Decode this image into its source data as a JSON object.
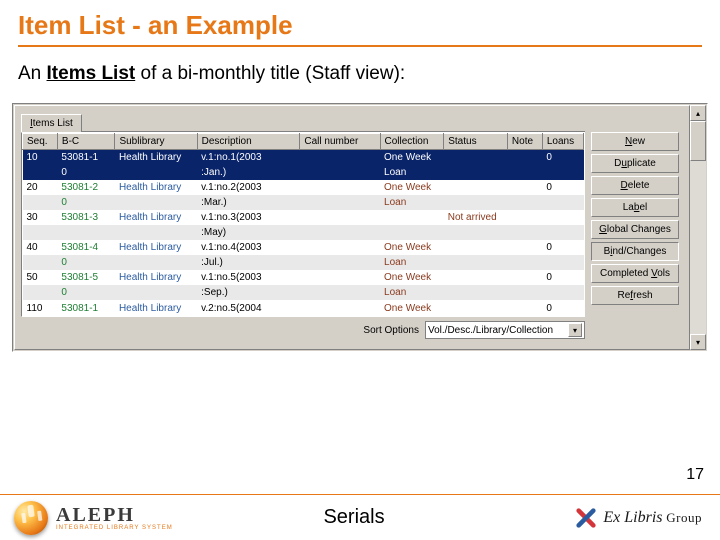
{
  "slide": {
    "title": "Item List - an Example",
    "subtitle_pre": "An ",
    "subtitle_bold": "Items List",
    "subtitle_post": " of a bi-monthly title (Staff view):",
    "page_number": "17",
    "footer_center": "Serials",
    "brand_name": "ALEPH",
    "brand_sub": "INTEGRATED LIBRARY SYSTEM",
    "vendor_prefix": "Ex Libris",
    "vendor_suffix": " Group"
  },
  "tab": {
    "prefix": "I",
    "rest": "tems List"
  },
  "columns": {
    "seq": "Seq.",
    "bc": "B-C",
    "sublibrary": "Sublibrary",
    "description": "Description",
    "callnumber": "Call number",
    "collection": "Collection",
    "status": "Status",
    "note": "Note",
    "loans": "Loans"
  },
  "rows": [
    {
      "seq": "10",
      "bc": "53081-1",
      "bc2": "0",
      "sub": "Health Library",
      "desc1": "v.1:no.1(2003",
      "desc2": ":Jan.)",
      "coll": "One Week",
      "status": "Loan",
      "loans": "0",
      "selected": true
    },
    {
      "seq": "20",
      "bc": "53081-2",
      "bc2": "0",
      "sub": "Health Library",
      "desc1": "v.1:no.2(2003",
      "desc2": ":Mar.)",
      "coll": "One Week",
      "status": "Loan",
      "loans": "0"
    },
    {
      "seq": "30",
      "bc": "53081-3",
      "bc2": "",
      "sub": "Health Library",
      "desc1": "v.1:no.3(2003",
      "desc2": ":May)",
      "coll": "",
      "status": "Not arrived",
      "loans": ""
    },
    {
      "seq": "40",
      "bc": "53081-4",
      "bc2": "0",
      "sub": "Health Library",
      "desc1": "v.1:no.4(2003",
      "desc2": ":Jul.)",
      "coll": "One Week",
      "status": "Loan",
      "loans": "0"
    },
    {
      "seq": "50",
      "bc": "53081-5",
      "bc2": "0",
      "sub": "Health Library",
      "desc1": "v.1:no.5(2003",
      "desc2": ":Sep.)",
      "coll": "One Week",
      "status": "Loan",
      "loans": "0"
    },
    {
      "seq": "110",
      "bc": "53081-1",
      "bc2": "",
      "sub": "Health Library",
      "desc1": "v.2:no.5(2004",
      "desc2": "",
      "coll": "One Week",
      "status": "",
      "loans": "0",
      "cut": true
    }
  ],
  "sort": {
    "label": "Sort Options",
    "value": "Vol./Desc./Library/Collection"
  },
  "buttons": {
    "new": {
      "u": "N",
      "rest": "ew"
    },
    "duplicate": {
      "pre": "D",
      "u": "u",
      "rest": "plicate"
    },
    "delete": {
      "u": "D",
      "rest": "elete"
    },
    "label": {
      "pre": "La",
      "u": "b",
      "rest": "el"
    },
    "global": {
      "u": "G",
      "rest": "lobal Changes"
    },
    "bind": {
      "pre": "B",
      "u": "i",
      "rest": "nd/Changes"
    },
    "completed": {
      "pre": "Completed ",
      "u": "V",
      "rest": "ols"
    },
    "refresh": {
      "pre": "Re",
      "u": "f",
      "rest": "resh"
    }
  },
  "chart_data": {
    "type": "table",
    "title": "Items List",
    "columns": [
      "Seq.",
      "B-C",
      "Sublibrary",
      "Description",
      "Call number",
      "Collection",
      "Status",
      "Note",
      "Loans"
    ],
    "rows_visible": 6
  }
}
